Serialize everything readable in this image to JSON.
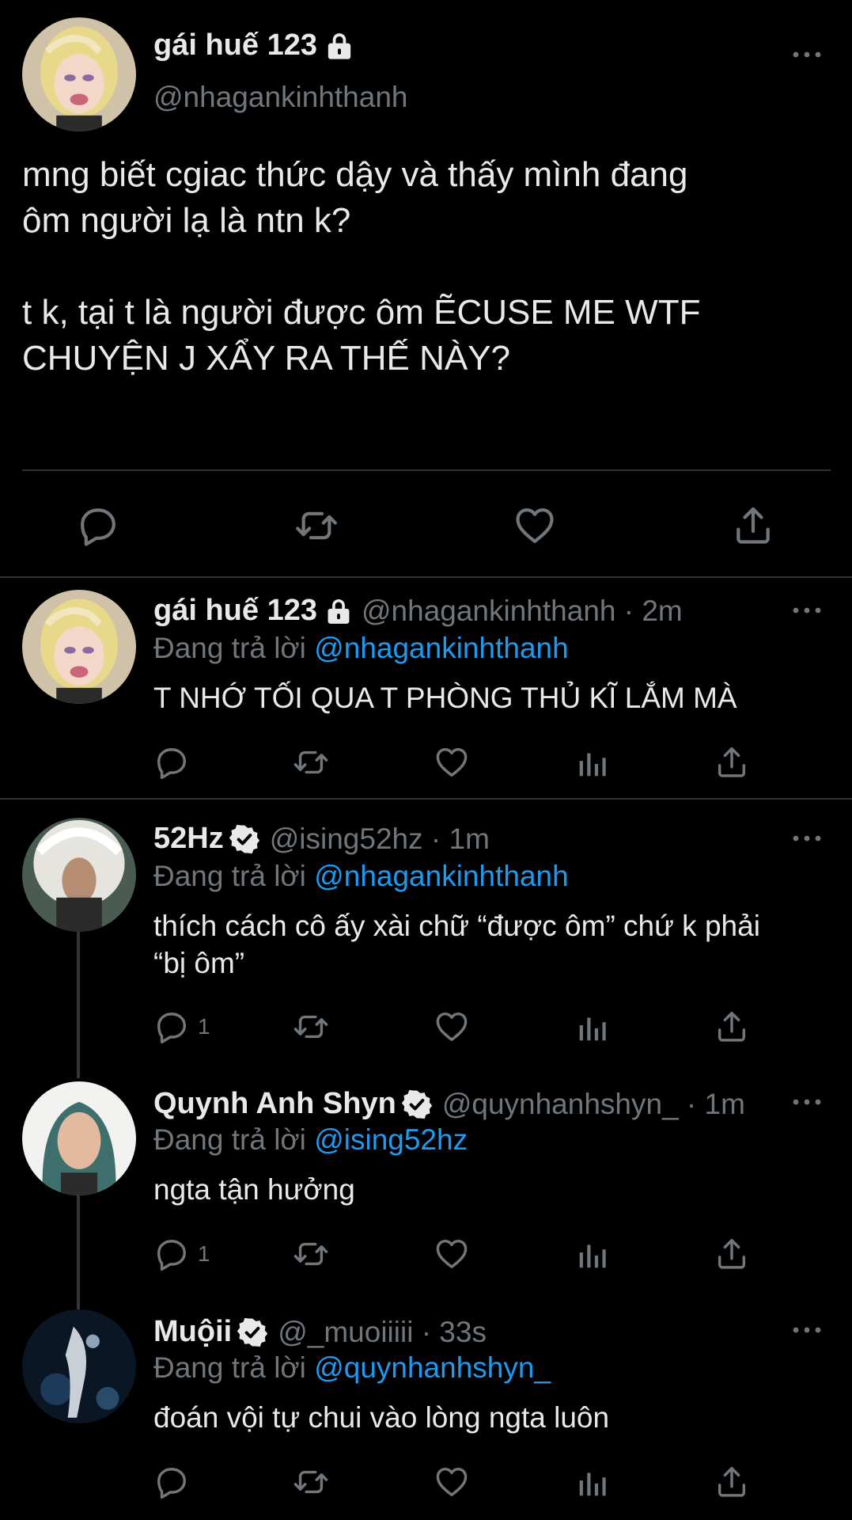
{
  "main_tweet": {
    "display_name": "gái huế 123",
    "handle": "@nhagankinhthanh",
    "text_line1": "mng biết cgiac thức dậy và thấy mình đang",
    "text_line2": "ôm người lạ là ntn k?",
    "text_line3": "t k, tại t là người được ôm ẼCUSE ME WTF",
    "text_line4": "CHUYỆN J XẨY RA THẾ NÀY?",
    "actions": [
      "reply-icon",
      "retweet-icon",
      "like-icon",
      "share-icon"
    ]
  },
  "replies": [
    {
      "display_name": "gái huế 123",
      "handle_time": "@nhagankinhthanh · 2m",
      "replying_prefix": "Đang trả lời ",
      "replying_to": "@nhagankinhthanh",
      "text_line1": "T NHỚ TỐI QUA T PHÒNG THỦ KĨ LẮM MÀ",
      "text_line2": "",
      "reply_count": "",
      "verified": false,
      "locked": true
    },
    {
      "display_name": "52Hz",
      "handle_time": "@ising52hz · 1m",
      "replying_prefix": "Đang trả lời ",
      "replying_to": "@nhagankinhthanh",
      "text_line1": "thích cách cô ấy xài chữ “được ôm” chứ k phải",
      "text_line2": "“bị ôm”",
      "reply_count": "1",
      "verified": true,
      "locked": false
    },
    {
      "display_name": "Quynh Anh Shyn",
      "handle_time": "@quynhanhshyn_ · 1m",
      "replying_prefix": "Đang trả lời ",
      "replying_to": "@ising52hz",
      "text_line1": "ngta tận hưởng",
      "text_line2": "",
      "reply_count": "1",
      "verified": true,
      "locked": false
    },
    {
      "display_name": "Muộii",
      "handle_time": "@_muoiiiii · 33s",
      "replying_prefix": "Đang trả lời ",
      "replying_to": "@quynhanhshyn_",
      "text_line1": "đoán vội tự chui vào lòng ngta luôn",
      "text_line2": "",
      "reply_count": "",
      "verified": true,
      "locked": false
    }
  ],
  "colors": {
    "background": "#000000",
    "text": "#e7e9ea",
    "secondary": "#71767b",
    "link": "#1d9bf0",
    "separator": "#2f3336"
  }
}
